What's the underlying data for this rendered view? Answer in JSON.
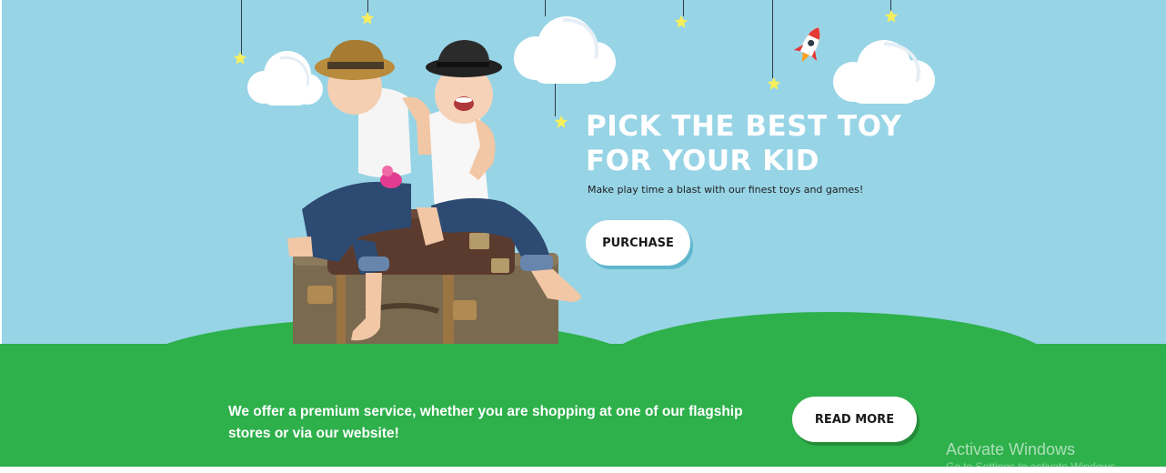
{
  "hero": {
    "headline_line1": "PICK THE BEST TOY",
    "headline_line2": "FOR YOUR KID",
    "subtitle": "Make play time a blast with our finest toys and games!",
    "purchase_label": "PURCHASE"
  },
  "offer": {
    "text_line1": "We offer a premium service, whether you are shopping at one of our flagship",
    "text_line2": "stores or via our website!",
    "read_more_label": "READ MORE"
  },
  "watermark": {
    "title": "Activate Windows",
    "subtitle": "Go to Settings to activate Windows."
  },
  "colors": {
    "sky": "#97d4e6",
    "grass": "#2eb04b",
    "button_bg": "#ffffff",
    "star": "#f7ef5a"
  },
  "decorations": {
    "hanging_items": [
      "star-icon",
      "star-icon",
      "star-icon",
      "star-icon",
      "star-icon",
      "star-icon",
      "star-icon"
    ],
    "clouds": [
      "cloud-icon",
      "cloud-icon",
      "cloud-icon",
      "cloud-icon"
    ],
    "rocket": "rocket-icon",
    "photo": "kids-on-suitcases-photo"
  }
}
